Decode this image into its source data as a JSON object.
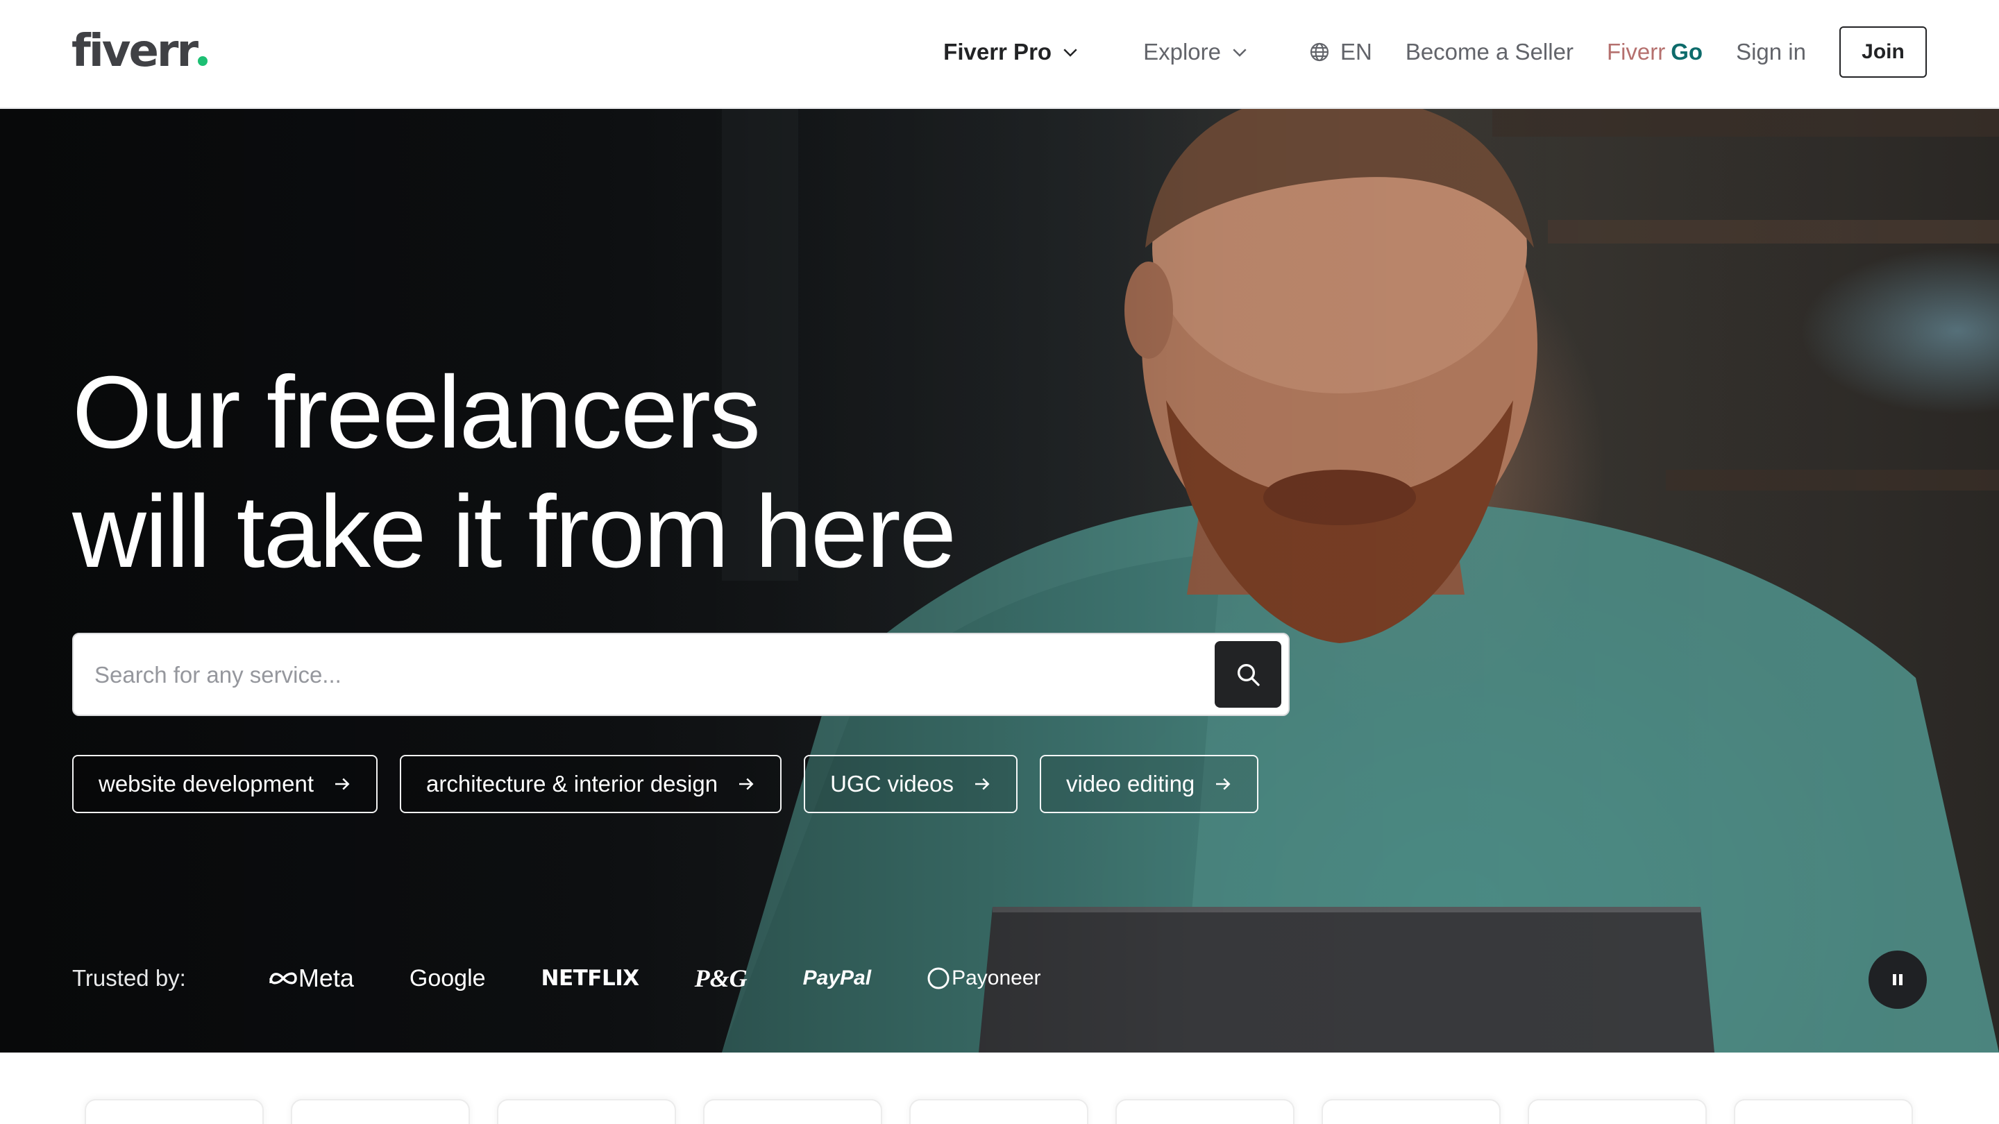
{
  "header": {
    "logo_text": "fiverr",
    "nav": {
      "fiverr_pro": "Fiverr Pro",
      "explore": "Explore",
      "language": "EN",
      "become_seller": "Become a Seller",
      "fiverr_go_a": "Fiverr",
      "fiverr_go_b": "Go",
      "sign_in": "Sign in",
      "join": "Join"
    }
  },
  "hero": {
    "headline_line1": "Our freelancers",
    "headline_line2": "will take it from here",
    "search": {
      "placeholder": "Search for any service...",
      "value": ""
    },
    "chips": [
      "website development",
      "architecture & interior design",
      "UGC videos",
      "video editing"
    ],
    "trusted_label": "Trusted by:",
    "brands": [
      "Meta",
      "Google",
      "NETFLIX",
      "P&G",
      "PayPal",
      "Payoneer"
    ]
  },
  "icons": {
    "chevron": "chevron-down-icon",
    "globe": "globe-icon",
    "search": "search-icon",
    "arrow": "arrow-right-icon",
    "pause": "pause-icon"
  },
  "colors": {
    "brand_green": "#1dbf73",
    "text_dark": "#222325",
    "text_muted": "#62646a",
    "fiverr_go_accent": "#0d6b6b"
  }
}
